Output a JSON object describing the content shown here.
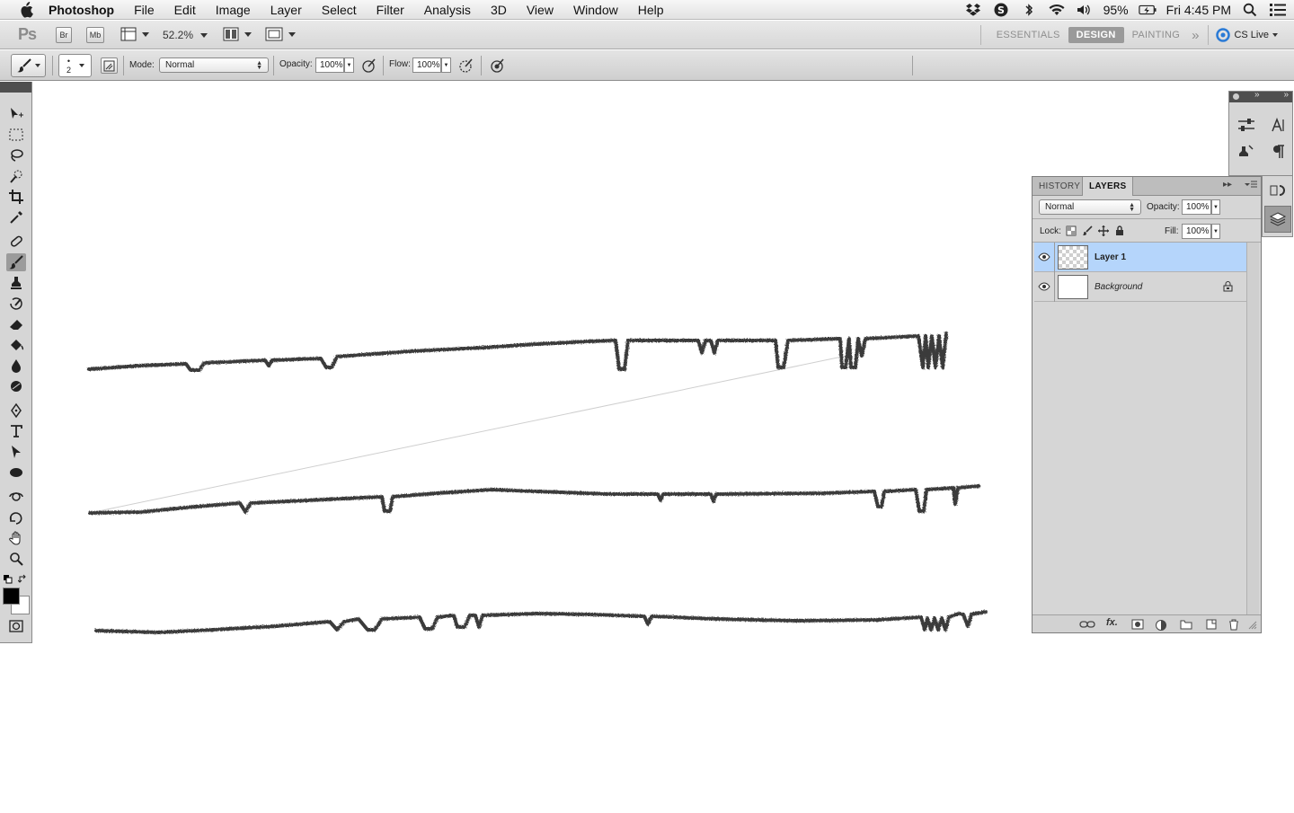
{
  "menubar": {
    "app_name": "Photoshop",
    "items": [
      "File",
      "Edit",
      "Image",
      "Layer",
      "Select",
      "Filter",
      "Analysis",
      "3D",
      "View",
      "Window",
      "Help"
    ],
    "battery": "95%",
    "clock": "Fri 4:45 PM"
  },
  "appbar": {
    "logo": "Ps",
    "bridge": "Br",
    "minibridge": "Mb",
    "zoom": "52.2%",
    "workspaces": [
      "ESSENTIALS",
      "DESIGN",
      "PAINTING"
    ],
    "active_workspace": "DESIGN",
    "cs_live": "CS Live"
  },
  "options": {
    "brush_size": "2",
    "mode_label": "Mode:",
    "mode_value": "Normal",
    "opacity_label": "Opacity:",
    "opacity_value": "100%",
    "flow_label": "Flow:",
    "flow_value": "100%"
  },
  "layers_panel": {
    "tabs": [
      "HISTORY",
      "LAYERS"
    ],
    "active_tab": "LAYERS",
    "blend_mode": "Normal",
    "opacity_label": "Opacity:",
    "opacity_value": "100%",
    "lock_label": "Lock:",
    "fill_label": "Fill:",
    "fill_value": "100%",
    "layers": [
      {
        "name": "Layer 1",
        "selected": true,
        "transparent": true,
        "locked": false
      },
      {
        "name": "Background",
        "selected": false,
        "transparent": false,
        "locked": true
      }
    ]
  },
  "colors": {
    "foreground": "#000000",
    "background": "#ffffff",
    "selection": "#b5d5fb"
  },
  "icons": {
    "tools": [
      "move-icon",
      "marquee-icon",
      "lasso-icon",
      "quick-selection-icon",
      "crop-icon",
      "eyedropper-icon",
      "healing-brush-icon",
      "brush-icon",
      "clone-stamp-icon",
      "history-brush-icon",
      "eraser-icon",
      "paint-bucket-icon",
      "blur-icon",
      "dodge-icon",
      "pen-icon",
      "type-icon",
      "path-selection-icon",
      "ellipse-icon",
      "3d-rotate-icon",
      "3d-orbit-icon",
      "hand-icon",
      "zoom-icon"
    ],
    "active_tool": "brush-icon"
  }
}
